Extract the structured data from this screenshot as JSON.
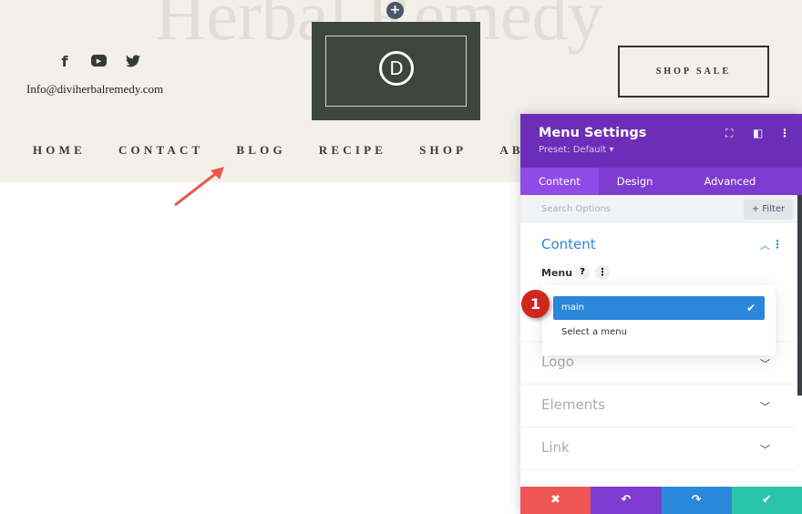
{
  "site": {
    "bg_title": "Herbal Remedy",
    "email": "Info@diviherbalremedy.com",
    "shop_button": "SHOP SALE",
    "logo_letter": "D",
    "add_icon": "+",
    "social": [
      {
        "icon": "facebook-icon",
        "glyph": "f"
      },
      {
        "icon": "youtube-icon",
        "glyph": "▶"
      },
      {
        "icon": "twitter-icon",
        "glyph": "🐦"
      }
    ],
    "nav": [
      "HOME",
      "CONTACT",
      "BLOG",
      "RECIPE",
      "SHOP",
      "AB"
    ]
  },
  "panel": {
    "title": "Menu Settings",
    "preset": "Preset: Default ▾",
    "tabs": [
      "Content",
      "Design",
      "Advanced"
    ],
    "search_placeholder": "Search Options",
    "filter": "+ Filter",
    "content_heading": "Content",
    "menu_label": "Menu",
    "help": "?",
    "dropdown": {
      "selected": "main",
      "other": "Select a menu"
    },
    "step_badge": "1",
    "sections": [
      "Logo",
      "Elements",
      "Link"
    ],
    "footer": {
      "close": "✖",
      "undo": "↶",
      "redo": "↷",
      "save": "✔"
    },
    "colors": {
      "header": "#6c2eb9",
      "tab_bar": "#7e3bd0",
      "close": "#ef5555",
      "undo": "#7d3bcf",
      "redo": "#2b87da",
      "save": "#29c4a9",
      "heading": "#2b87da"
    }
  }
}
